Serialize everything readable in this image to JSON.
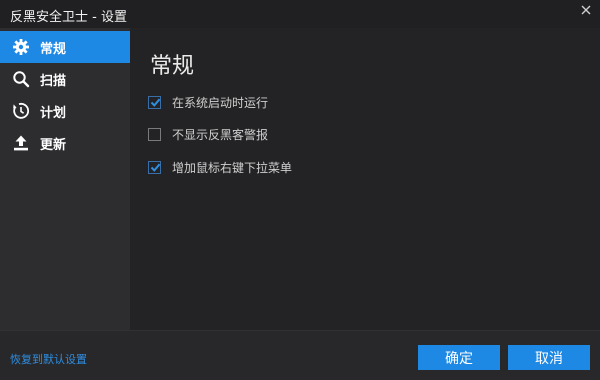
{
  "window": {
    "title": "反黑安全卫士 - 设置",
    "close_icon": "close-icon"
  },
  "sidebar": {
    "items": [
      {
        "label": "常规",
        "icon": "gear-icon",
        "active": true
      },
      {
        "label": "扫描",
        "icon": "search-icon",
        "active": false
      },
      {
        "label": "计划",
        "icon": "clock-icon",
        "active": false
      },
      {
        "label": "更新",
        "icon": "upload-icon",
        "active": false
      }
    ]
  },
  "main": {
    "title": "常规",
    "options": [
      {
        "label": "在系统启动时运行",
        "checked": true
      },
      {
        "label": "不显示反黑客警报",
        "checked": false
      },
      {
        "label": "增加鼠标右键下拉菜单",
        "checked": true
      }
    ]
  },
  "footer": {
    "restore_label": "恢复到默认设置",
    "ok_label": "确定",
    "cancel_label": "取消"
  },
  "colors": {
    "accent": "#1e88e5",
    "link": "#2f8ee0",
    "sidebar_bg": "#2d2d30",
    "content_bg": "#232325"
  }
}
